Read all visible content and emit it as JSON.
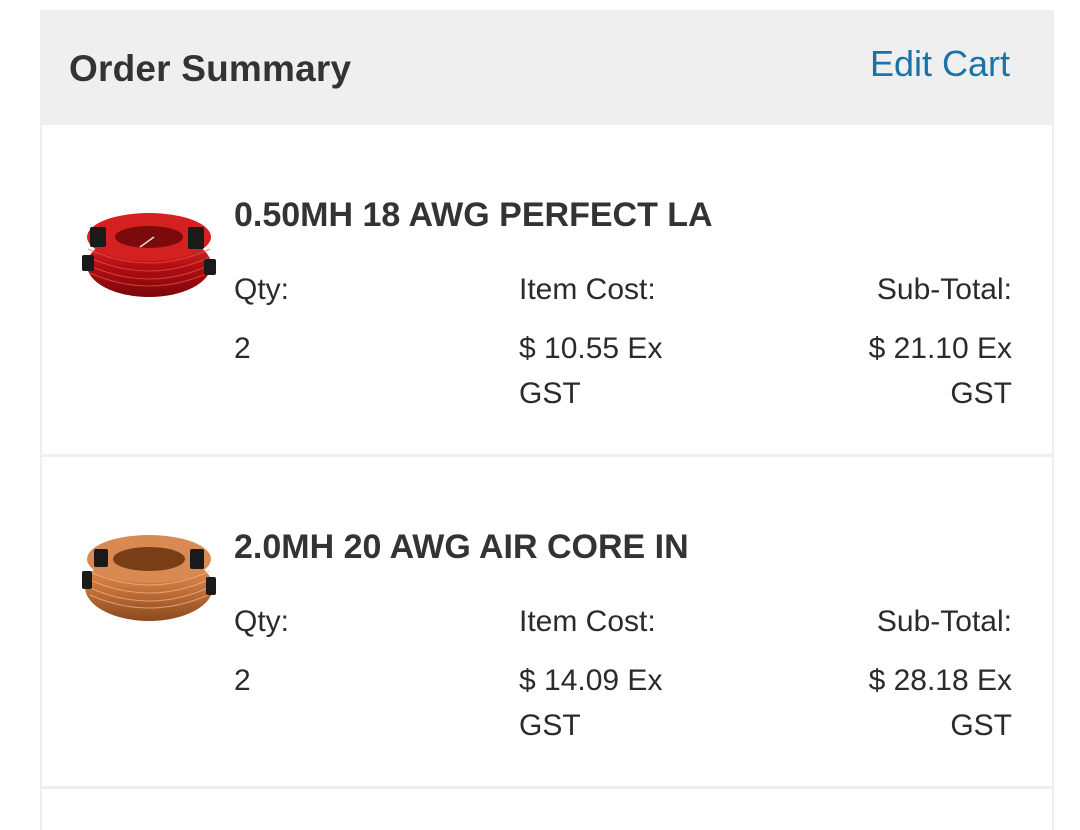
{
  "header": {
    "title": "Order Summary",
    "edit_link": "Edit Cart"
  },
  "items": [
    {
      "name": "0.50MH 18 AWG PERFECT LA",
      "qty_label": "Qty:",
      "qty": "2",
      "cost_label": "Item Cost:",
      "cost": "$ 10.55 Ex GST",
      "subtotal_label": "Sub-Total:",
      "subtotal": "$ 21.10 Ex GST",
      "image_icon": "red-copper-coil-image",
      "coil_color": "#c41a1a"
    },
    {
      "name": "2.0MH 20 AWG AIR CORE IN",
      "qty_label": "Qty:",
      "qty": "2",
      "cost_label": "Item Cost:",
      "cost": "$ 14.09 Ex GST",
      "subtotal_label": "Sub-Total:",
      "subtotal": "$ 28.18 Ex GST",
      "image_icon": "copper-coil-image",
      "coil_color": "#c8743b"
    }
  ],
  "colors": {
    "link": "#1a73a8",
    "header_bg": "#efefef",
    "text": "#2b2b2b"
  }
}
